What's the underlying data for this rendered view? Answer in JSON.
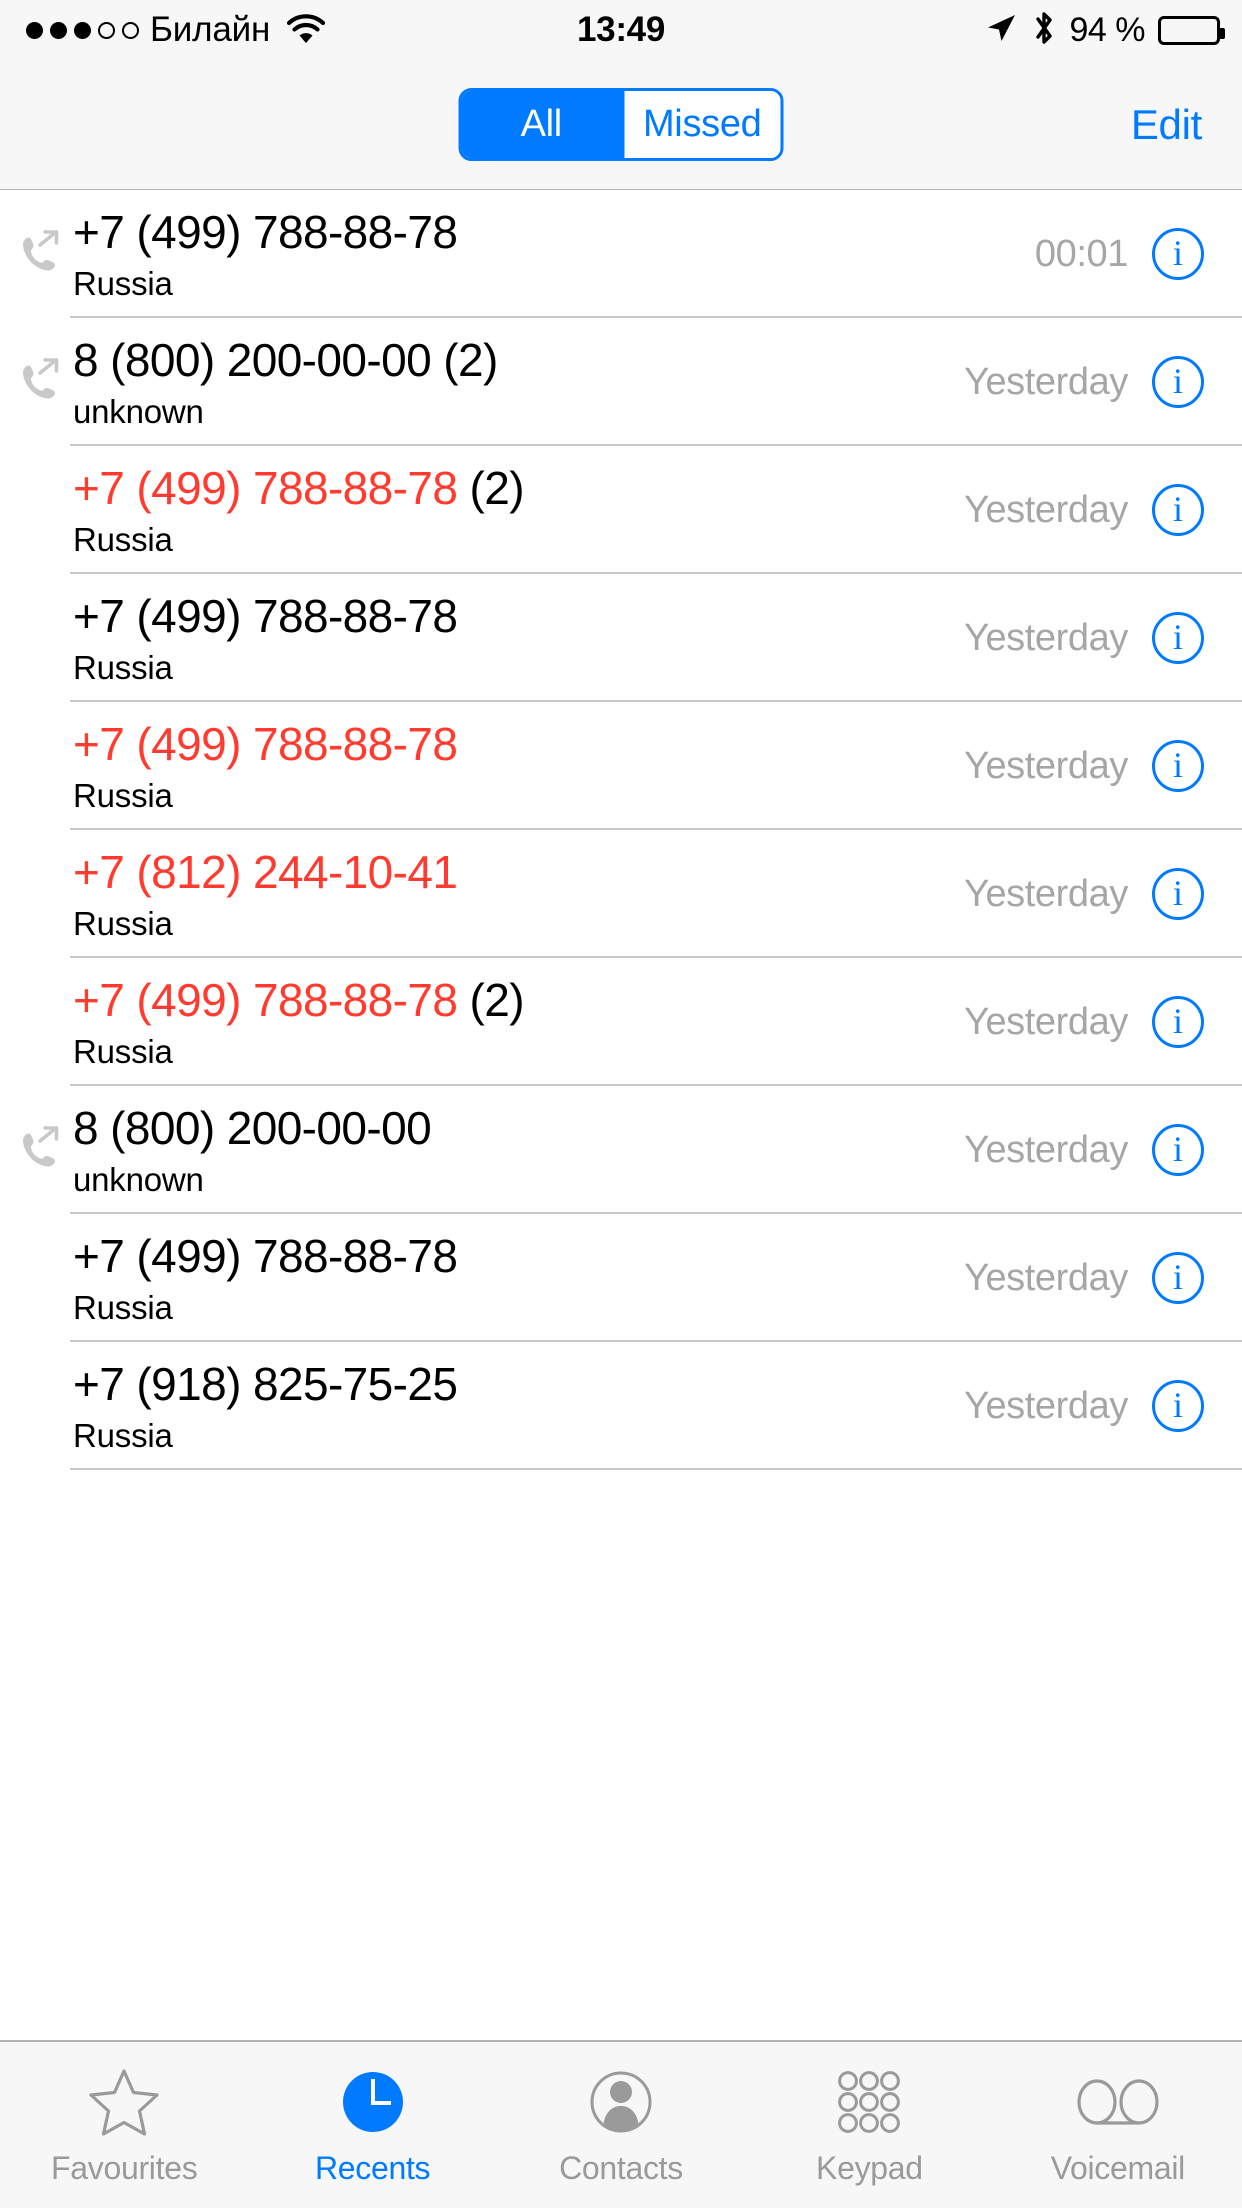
{
  "status_bar": {
    "signal_dots": [
      true,
      true,
      true,
      false,
      false
    ],
    "carrier": "Билайн",
    "wifi_icon": "wifi-icon",
    "time": "13:49",
    "location_icon": "location-arrow-icon",
    "bluetooth_icon": "bluetooth-icon",
    "battery_percent": "94 %",
    "battery_level": 94
  },
  "nav_bar": {
    "segments": [
      {
        "label": "All",
        "selected": true
      },
      {
        "label": "Missed",
        "selected": false
      }
    ],
    "edit_label": "Edit"
  },
  "colors": {
    "accent_blue": "#007aff",
    "missed_red": "#ff3b30",
    "bar_background": "#f7f7f7",
    "secondary_text": "#a6a6a6",
    "separator": "#c8c7cc"
  },
  "calls": [
    {
      "number": "+7 (499) 788-88-78",
      "count": "",
      "location": "Russia",
      "when": "00:01",
      "missed": false,
      "direction_icon": "outgoing-call-icon",
      "show_direction": true
    },
    {
      "number": "8 (800) 200-00-00",
      "count": "(2)",
      "location": "unknown",
      "when": "Yesterday",
      "missed": false,
      "direction_icon": "outgoing-call-icon",
      "show_direction": true
    },
    {
      "number": "+7 (499) 788-88-78",
      "count": "(2)",
      "location": "Russia",
      "when": "Yesterday",
      "missed": true,
      "direction_icon": "",
      "show_direction": false
    },
    {
      "number": "+7 (499) 788-88-78",
      "count": "",
      "location": "Russia",
      "when": "Yesterday",
      "missed": false,
      "direction_icon": "",
      "show_direction": false
    },
    {
      "number": "+7 (499) 788-88-78",
      "count": "",
      "location": "Russia",
      "when": "Yesterday",
      "missed": true,
      "direction_icon": "",
      "show_direction": false
    },
    {
      "number": "+7 (812) 244-10-41",
      "count": "",
      "location": "Russia",
      "when": "Yesterday",
      "missed": true,
      "direction_icon": "",
      "show_direction": false
    },
    {
      "number": "+7 (499) 788-88-78",
      "count": "(2)",
      "location": "Russia",
      "when": "Yesterday",
      "missed": true,
      "direction_icon": "",
      "show_direction": false
    },
    {
      "number": "8 (800) 200-00-00",
      "count": "",
      "location": "unknown",
      "when": "Yesterday",
      "missed": false,
      "direction_icon": "outgoing-call-icon",
      "show_direction": true
    },
    {
      "number": "+7 (499) 788-88-78",
      "count": "",
      "location": "Russia",
      "when": "Yesterday",
      "missed": false,
      "direction_icon": "",
      "show_direction": false
    },
    {
      "number": "+7 (918) 825-75-25",
      "count": "",
      "location": "Russia",
      "when": "Yesterday",
      "missed": false,
      "direction_icon": "",
      "show_direction": false
    }
  ],
  "info_button_glyph": "i",
  "tab_bar": {
    "tabs": [
      {
        "label": "Favourites",
        "icon": "star-icon",
        "active": false
      },
      {
        "label": "Recents",
        "icon": "clock-icon",
        "active": true
      },
      {
        "label": "Contacts",
        "icon": "person-icon",
        "active": false
      },
      {
        "label": "Keypad",
        "icon": "keypad-icon",
        "active": false
      },
      {
        "label": "Voicemail",
        "icon": "voicemail-icon",
        "active": false
      }
    ]
  }
}
